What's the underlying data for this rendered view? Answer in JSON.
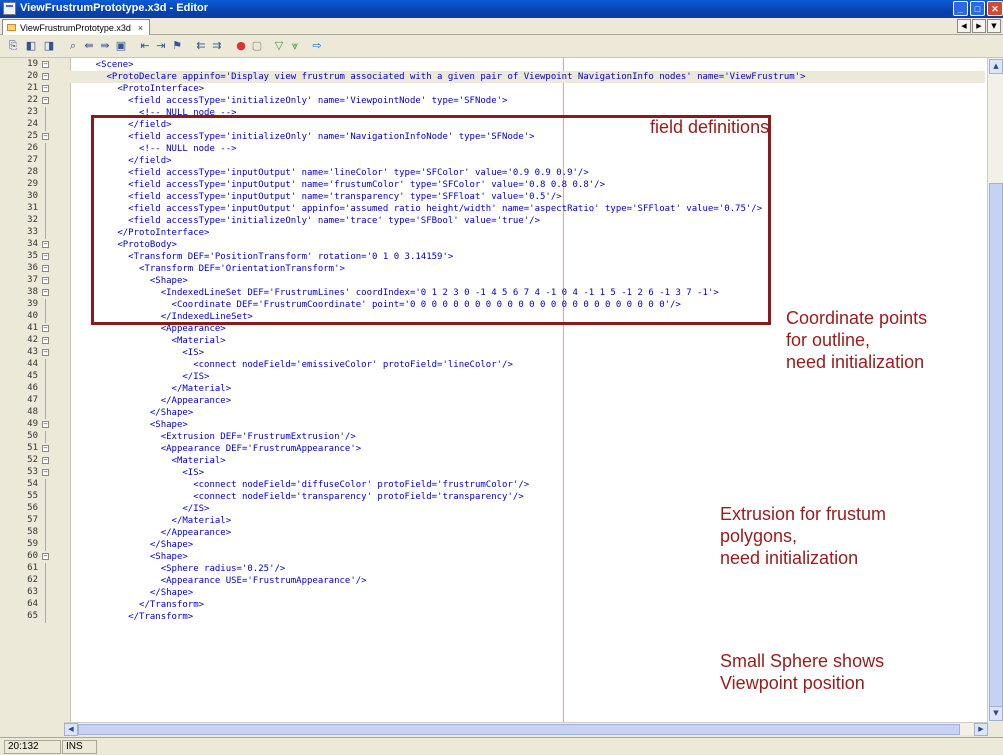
{
  "window": {
    "title": "ViewFrustrumPrototype.x3d - Editor"
  },
  "tab": {
    "label": "ViewFrustrumPrototype.x3d",
    "close": "×"
  },
  "editor": {
    "lines": [
      {
        "num": "19",
        "fold": "−",
        "text": "    <Scene>"
      },
      {
        "num": "20",
        "fold": "−",
        "text": "      <ProtoDeclare appinfo='Display view frustrum associated with a given pair of Viewpoint NavigationInfo nodes' name='ViewFrustrum'>"
      },
      {
        "num": "21",
        "fold": "−",
        "text": "        <ProtoInterface>"
      },
      {
        "num": "22",
        "fold": "−",
        "text": "          <field accessType='initializeOnly' name='ViewpointNode' type='SFNode'>"
      },
      {
        "num": "23",
        "fold": "",
        "text": "            <!-- NULL node -->"
      },
      {
        "num": "24",
        "fold": "",
        "text": "          </field>"
      },
      {
        "num": "25",
        "fold": "−",
        "text": "          <field accessType='initializeOnly' name='NavigationInfoNode' type='SFNode'>"
      },
      {
        "num": "26",
        "fold": "",
        "text": "            <!-- NULL node -->"
      },
      {
        "num": "27",
        "fold": "",
        "text": "          </field>"
      },
      {
        "num": "28",
        "fold": "",
        "text": "          <field accessType='inputOutput' name='lineColor' type='SFColor' value='0.9 0.9 0.9'/>"
      },
      {
        "num": "29",
        "fold": "",
        "text": "          <field accessType='inputOutput' name='frustumColor' type='SFColor' value='0.8 0.8 0.8'/>"
      },
      {
        "num": "30",
        "fold": "",
        "text": "          <field accessType='inputOutput' name='transparency' type='SFFloat' value='0.5'/>"
      },
      {
        "num": "31",
        "fold": "",
        "text": "          <field accessType='inputOutput' appinfo='assumed ratio height/width' name='aspectRatio' type='SFFloat' value='0.75'/>"
      },
      {
        "num": "32",
        "fold": "",
        "text": "          <field accessType='initializeOnly' name='trace' type='SFBool' value='true'/>"
      },
      {
        "num": "33",
        "fold": "",
        "text": "        </ProtoInterface>"
      },
      {
        "num": "34",
        "fold": "−",
        "text": "        <ProtoBody>"
      },
      {
        "num": "35",
        "fold": "−",
        "text": "          <Transform DEF='PositionTransform' rotation='0 1 0 3.14159'>"
      },
      {
        "num": "36",
        "fold": "−",
        "text": "            <Transform DEF='OrientationTransform'>"
      },
      {
        "num": "37",
        "fold": "−",
        "text": "              <Shape>"
      },
      {
        "num": "38",
        "fold": "−",
        "text": "                <IndexedLineSet DEF='FrustrumLines' coordIndex='0 1 2 3 0 -1 4 5 6 7 4 -1 0 4 -1 1 5 -1 2 6 -1 3 7 -1'>"
      },
      {
        "num": "39",
        "fold": "",
        "text": "                  <Coordinate DEF='FrustrumCoordinate' point='0 0 0 0 0 0 0 0 0 0 0 0 0 0 0 0 0 0 0 0 0 0 0 0'/>"
      },
      {
        "num": "40",
        "fold": "",
        "text": "                </IndexedLineSet>"
      },
      {
        "num": "41",
        "fold": "−",
        "text": "                <Appearance>"
      },
      {
        "num": "42",
        "fold": "−",
        "text": "                  <Material>"
      },
      {
        "num": "43",
        "fold": "−",
        "text": "                    <IS>"
      },
      {
        "num": "44",
        "fold": "",
        "text": "                      <connect nodeField='emissiveColor' protoField='lineColor'/>"
      },
      {
        "num": "45",
        "fold": "",
        "text": "                    </IS>"
      },
      {
        "num": "46",
        "fold": "",
        "text": "                  </Material>"
      },
      {
        "num": "47",
        "fold": "",
        "text": "                </Appearance>"
      },
      {
        "num": "48",
        "fold": "",
        "text": "              </Shape>"
      },
      {
        "num": "49",
        "fold": "−",
        "text": "              <Shape>"
      },
      {
        "num": "50",
        "fold": "",
        "text": "                <Extrusion DEF='FrustrumExtrusion'/>"
      },
      {
        "num": "51",
        "fold": "−",
        "text": "                <Appearance DEF='FrustrumAppearance'>"
      },
      {
        "num": "52",
        "fold": "−",
        "text": "                  <Material>"
      },
      {
        "num": "53",
        "fold": "−",
        "text": "                    <IS>"
      },
      {
        "num": "54",
        "fold": "",
        "text": "                      <connect nodeField='diffuseColor' protoField='frustrumColor'/>"
      },
      {
        "num": "55",
        "fold": "",
        "text": "                      <connect nodeField='transparency' protoField='transparency'/>"
      },
      {
        "num": "56",
        "fold": "",
        "text": "                    </IS>"
      },
      {
        "num": "57",
        "fold": "",
        "text": "                  </Material>"
      },
      {
        "num": "58",
        "fold": "",
        "text": "                </Appearance>"
      },
      {
        "num": "59",
        "fold": "",
        "text": "              </Shape>"
      },
      {
        "num": "60",
        "fold": "−",
        "text": "              <Shape>"
      },
      {
        "num": "61",
        "fold": "",
        "text": "                <Sphere radius='0.25'/>"
      },
      {
        "num": "62",
        "fold": "",
        "text": "                <Appearance USE='FrustrumAppearance'/>"
      },
      {
        "num": "63",
        "fold": "",
        "text": "              </Shape>"
      },
      {
        "num": "64",
        "fold": "",
        "text": "            </Transform>"
      },
      {
        "num": "65",
        "fold": "",
        "text": "          </Transform>"
      }
    ]
  },
  "annotations": {
    "field_definitions": "field definitions",
    "coordinate": "Coordinate points\nfor outline,\nneed initialization",
    "extrusion": "Extrusion for frustum\npolygons,\nneed initialization",
    "sphere": "Small Sphere shows\nViewpoint position",
    "color": "#9b1b1b"
  },
  "status": {
    "position": "20:132",
    "mode": "INS"
  }
}
